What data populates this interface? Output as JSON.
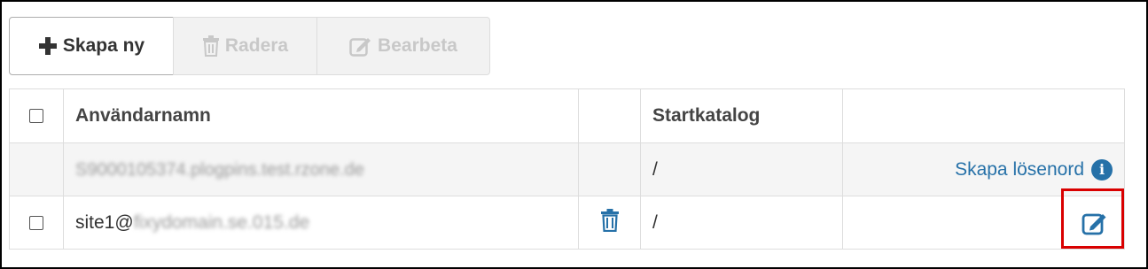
{
  "toolbar": {
    "create_label": "Skapa ny",
    "delete_label": "Radera",
    "edit_label": "Bearbeta"
  },
  "table": {
    "headers": {
      "username": "Användarnamn",
      "home_dir": "Startkatalog"
    },
    "rows": [
      {
        "username": "S9000105374.plogpins.test.rzone.de",
        "home_dir": "/",
        "action_label": "Skapa lösenord"
      },
      {
        "username_prefix": "site1@",
        "username_blurred": "fixydomain.se.015.de",
        "home_dir": "/"
      }
    ]
  },
  "colors": {
    "link": "#2671a8",
    "highlight": "#d90000"
  },
  "icons": {
    "create": "plus-icon",
    "delete": "trash-icon",
    "edit": "edit-icon",
    "info": "info-icon"
  }
}
